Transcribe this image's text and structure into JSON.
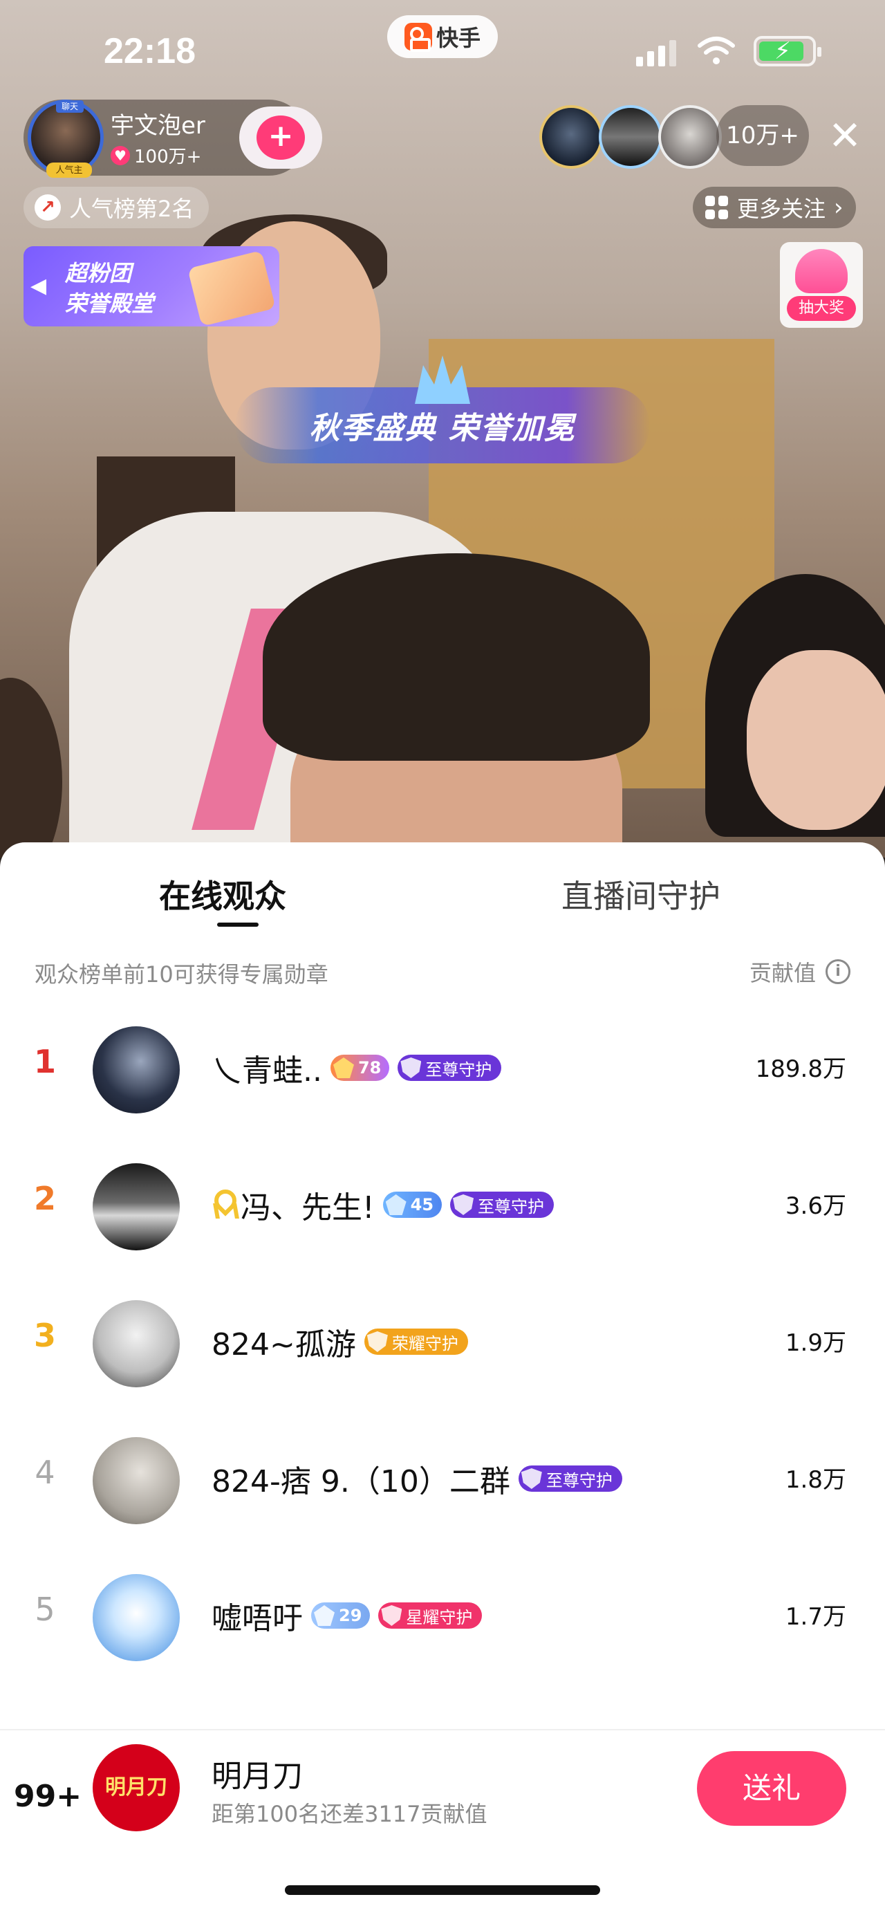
{
  "status_bar": {
    "time": "22:18",
    "app_name": "快手"
  },
  "host": {
    "name": "宇文泡er",
    "likes": "100万+",
    "avatar_badge_top": "聊天",
    "avatar_badge_bottom": "人气主",
    "follow_icon": "plus-heart-icon"
  },
  "top_right": {
    "viewer_count": "10万+",
    "close_icon": "close-icon"
  },
  "chips": {
    "popularity": "人气榜第2名",
    "more_follow": "更多关注"
  },
  "fan_banner": {
    "line1": "超粉团",
    "line2": "荣誉殿堂"
  },
  "lottery": {
    "label": "抽大奖"
  },
  "event_banner": {
    "text": "秋季盛典 荣誉加冕"
  },
  "sheet": {
    "tabs": [
      {
        "label": "在线观众",
        "active": true
      },
      {
        "label": "直播间守护",
        "active": false
      }
    ],
    "hint": "观众榜单前10可获得专属勋章",
    "contribution_header": "贡献值"
  },
  "viewers": [
    {
      "rank": "1",
      "name": "乀青蛙..",
      "level": "78",
      "guard": "至尊守护",
      "value": "189.8万"
    },
    {
      "rank": "2",
      "name": "冯、先生!",
      "level": "45",
      "guard": "至尊守护",
      "value": "3.6万"
    },
    {
      "rank": "3",
      "name": "824~孤游",
      "level": "",
      "guard": "荣耀守护",
      "value": "1.9万"
    },
    {
      "rank": "4",
      "name": "824-痞 9.（10）二群",
      "level": "",
      "guard": "至尊守护",
      "value": "1.8万"
    },
    {
      "rank": "5",
      "name": "嘘唔吁",
      "level": "29",
      "guard": "星耀守护",
      "value": "1.7万"
    }
  ],
  "self": {
    "rank": "99+",
    "avatar_text": "明月刀",
    "name": "明月刀",
    "subtitle": "距第100名还差3117贡献值",
    "gift_button": "送礼"
  },
  "colors": {
    "rank1": "#e0322f",
    "rank2": "#f07a2a",
    "rank3": "#f2b01e",
    "rank_other": "#a8a8a8",
    "accent_pink": "#ff3d6e",
    "guard_purple": "#6a35d8",
    "guard_gold": "#f2a31c",
    "guard_pink": "#f0336a"
  }
}
